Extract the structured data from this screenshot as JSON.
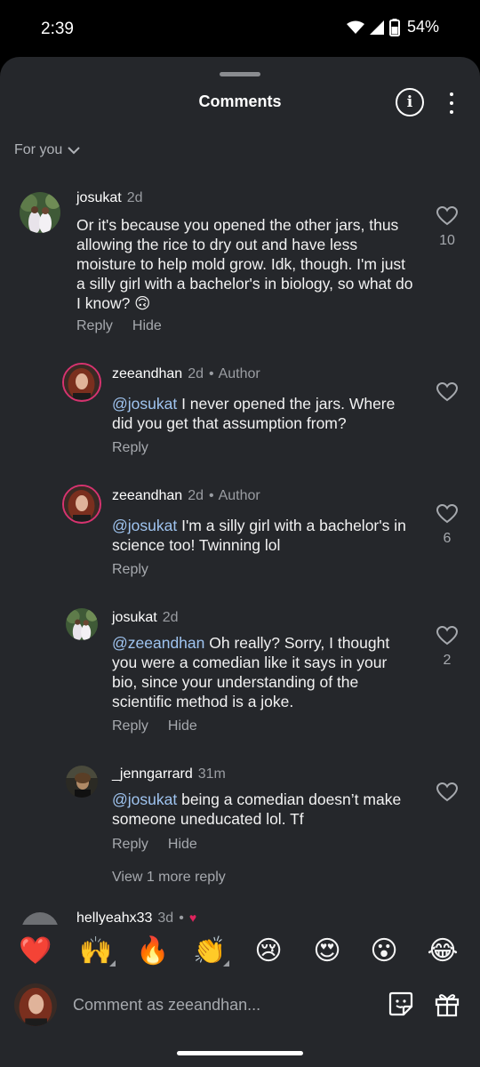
{
  "status": {
    "time": "2:39",
    "battery": "54%"
  },
  "header": {
    "title": "Comments",
    "filter": "For you"
  },
  "comments": [
    {
      "username": "josukat",
      "time": "2d",
      "badge": "",
      "text": "Or it's because you opened the other jars, thus allowing the rice to dry out and have less moisture to help mold grow. Idk, though. I'm just a silly girl with a bachelor's in biology, so what do I know? 🙃",
      "mention": "",
      "likes": "10",
      "reply": "Reply",
      "hide": "Hide"
    },
    {
      "username": "zeeandhan",
      "time": "2d",
      "badge": "Author",
      "mention": "@josukat",
      "text": " I never opened the jars. Where did you get that assumption from?",
      "likes": "",
      "reply": "Reply",
      "hide": ""
    },
    {
      "username": "zeeandhan",
      "time": "2d",
      "badge": "Author",
      "mention": "@josukat",
      "text": " I'm a silly girl with a bachelor's in science too! Twinning lol",
      "likes": "6",
      "reply": "Reply",
      "hide": ""
    },
    {
      "username": "josukat",
      "time": "2d",
      "badge": "",
      "mention": "@zeeandhan",
      "text": " Oh really? Sorry, I thought you were a comedian like it says in your bio, since your understanding of the scientific method is a joke.",
      "likes": "2",
      "reply": "Reply",
      "hide": "Hide"
    },
    {
      "username": "_jenngarrard",
      "time": "31m",
      "badge": "",
      "mention": "@josukat",
      "text": " being a comedian doesn’t make someone uneducated lol. Tf",
      "likes": "",
      "reply": "Reply",
      "hide": "Hide"
    }
  ],
  "view_more": "View 1 more reply",
  "partial_comment": {
    "username": "hellyeahx33",
    "time": "3d"
  },
  "emojis": [
    "❤️",
    "🙌",
    "🔥",
    "👏",
    "😢",
    "😍",
    "😮",
    "😂"
  ],
  "composer": {
    "placeholder": "Comment as zeeandhan..."
  },
  "colors": {
    "sheet": "#25272b",
    "mention": "#9fc4f0",
    "muted": "#a6a9ae"
  }
}
